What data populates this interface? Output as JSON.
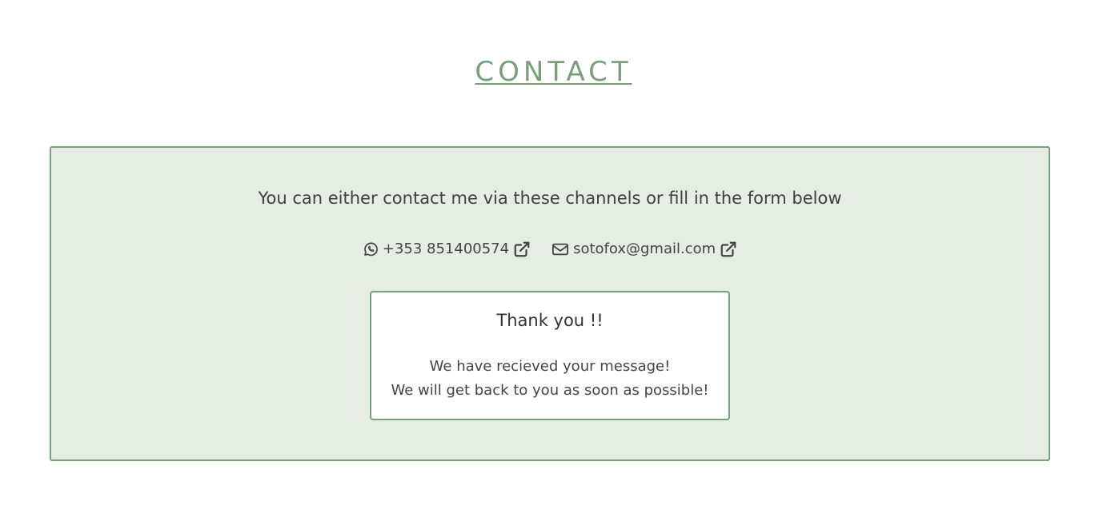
{
  "header": {
    "title": "CONTACT"
  },
  "panel": {
    "intro": "You can either contact me via these channels or fill in the form below",
    "channels": [
      {
        "icon": "whatsapp-icon",
        "label": "+353 851400574",
        "link_icon": "external-link-icon"
      },
      {
        "icon": "envelope-icon",
        "label": "sotofox@gmail.com",
        "link_icon": "external-link-icon"
      }
    ]
  },
  "confirmation": {
    "title": "Thank you !!",
    "line1": "We have recieved your message!",
    "line2": "We will get back to you as soon as possible!"
  },
  "colors": {
    "accent": "#7aa07a",
    "panel_bg": "#e6ede5",
    "text": "#3f3f3f"
  }
}
